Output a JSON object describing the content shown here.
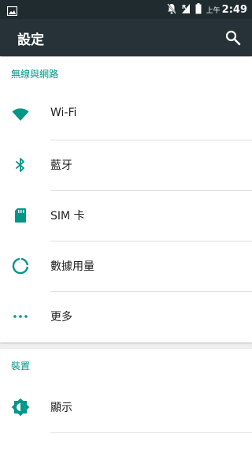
{
  "status_bar": {
    "icons": [
      "image-notification-icon",
      "notifications-off-icon",
      "signal-r-icon",
      "battery-icon"
    ],
    "ampm": "上午",
    "time": "2:49"
  },
  "app_bar": {
    "title": "設定",
    "search_icon": "search-icon"
  },
  "sections": [
    {
      "header": "無線與網路",
      "items": [
        {
          "label": "Wi-Fi",
          "icon": "wifi-icon"
        },
        {
          "label": "藍牙",
          "icon": "bluetooth-icon"
        },
        {
          "label": "SIM 卡",
          "icon": "sim-card-icon"
        },
        {
          "label": "數據用量",
          "icon": "data-usage-icon"
        },
        {
          "label": "更多",
          "icon": "more-horiz-icon"
        }
      ]
    },
    {
      "header": "裝置",
      "items": [
        {
          "label": "顯示",
          "icon": "brightness-icon"
        }
      ]
    }
  ],
  "colors": {
    "status_bar": "#1f2b2f",
    "app_bar": "#263238",
    "accent": "#009688",
    "background": "#eeeeee"
  }
}
